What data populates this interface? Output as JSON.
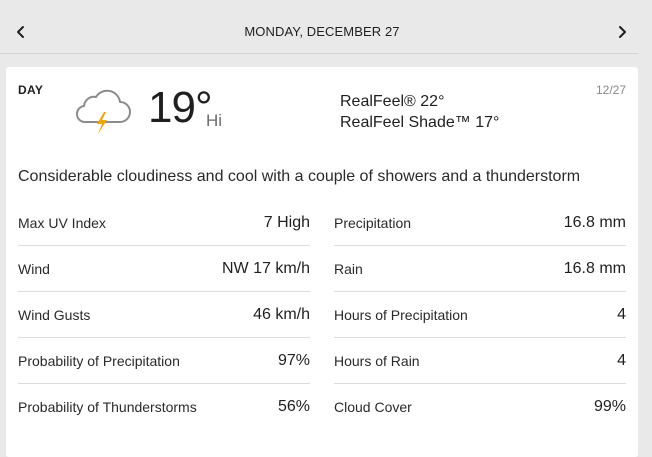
{
  "nav": {
    "date": "MONDAY, DECEMBER 27",
    "prev_icon": "chevron-left-icon",
    "next_icon": "chevron-right-icon"
  },
  "day": {
    "label": "DAY",
    "date": "12/27",
    "icon": "thunderstorm-cloud-icon",
    "temperature": "19°",
    "temp_type": "Hi",
    "realfeel": "RealFeel® 22°",
    "realfeel_shade": "RealFeel Shade™ 17°",
    "phrase": "Considerable cloudiness and cool with a couple of showers and a thunderstorm"
  },
  "details": {
    "left": [
      {
        "label": "Max UV Index",
        "value": "7 High"
      },
      {
        "label": "Wind",
        "value": "NW 17 km/h"
      },
      {
        "label": "Wind Gusts",
        "value": "46 km/h"
      },
      {
        "label": "Probability of Precipitation",
        "value": "97%"
      },
      {
        "label": "Probability of Thunderstorms",
        "value": "56%"
      }
    ],
    "right": [
      {
        "label": "Precipitation",
        "value": "16.8 mm"
      },
      {
        "label": "Rain",
        "value": "16.8 mm"
      },
      {
        "label": "Hours of Precipitation",
        "value": "4"
      },
      {
        "label": "Hours of Rain",
        "value": "4"
      },
      {
        "label": "Cloud Cover",
        "value": "99%"
      }
    ]
  },
  "colors": {
    "background": "#e9e9e9",
    "card": "#ffffff",
    "lightning": "#f0a500",
    "cloud_outline": "#8c8c8c"
  }
}
